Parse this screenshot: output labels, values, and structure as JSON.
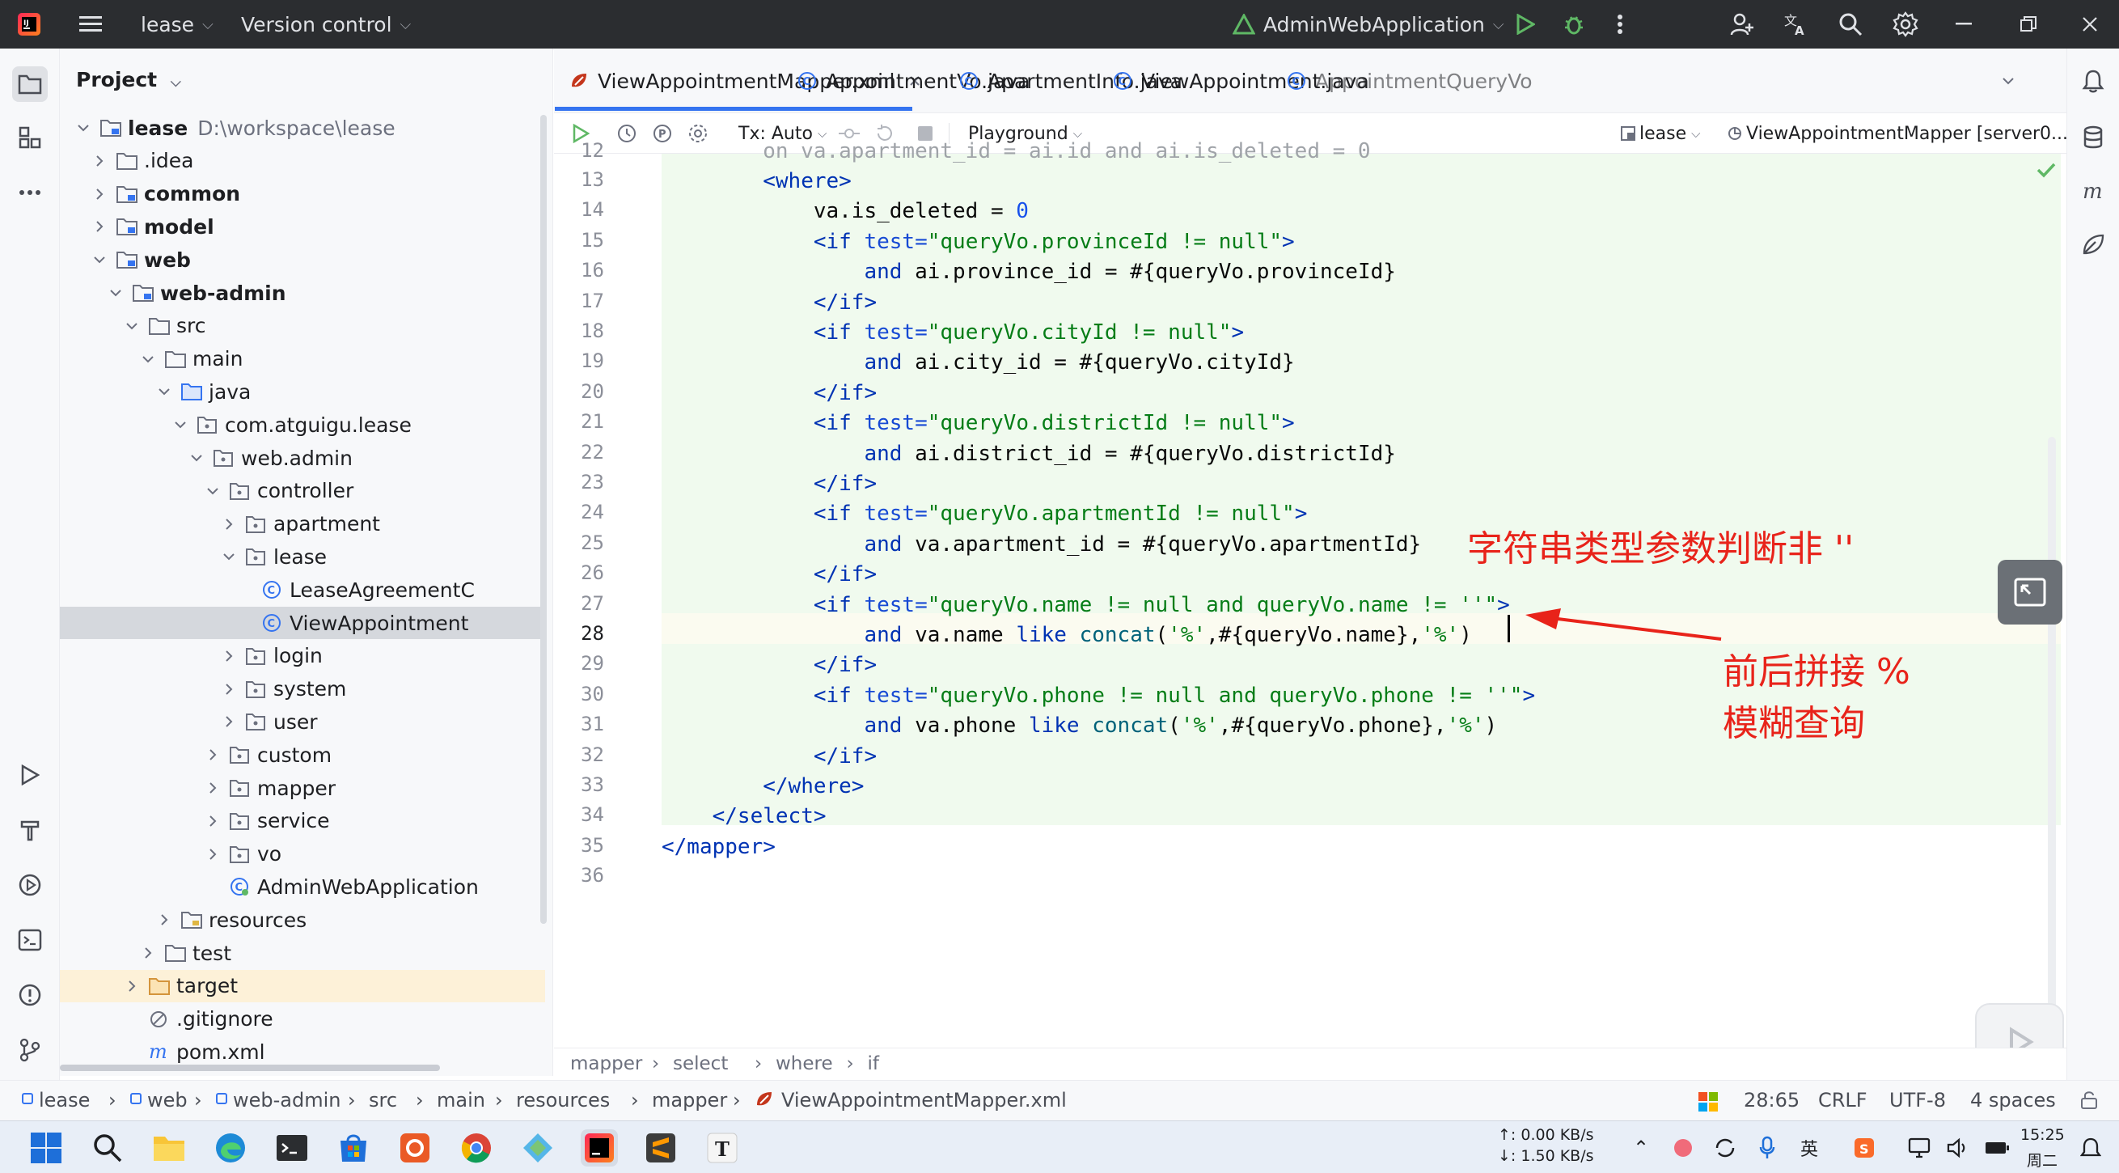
{
  "titlebar": {
    "project": "lease",
    "vcs": "Version control",
    "run_config": "AdminWebApplication"
  },
  "project_panel": {
    "title": "Project",
    "tree": [
      {
        "label": "lease",
        "path": "D:\\workspace\\lease",
        "bold": true,
        "level": 0,
        "open": true,
        "icon": "module"
      },
      {
        "label": ".idea",
        "level": 1,
        "open": false,
        "icon": "folder"
      },
      {
        "label": "common",
        "level": 1,
        "open": false,
        "icon": "module",
        "bold": true
      },
      {
        "label": "model",
        "level": 1,
        "open": false,
        "icon": "module",
        "bold": true
      },
      {
        "label": "web",
        "level": 1,
        "open": true,
        "icon": "module",
        "bold": true
      },
      {
        "label": "web-admin",
        "level": 2,
        "open": true,
        "icon": "module",
        "bold": true
      },
      {
        "label": "src",
        "level": 3,
        "open": true,
        "icon": "folder"
      },
      {
        "label": "main",
        "level": 4,
        "open": true,
        "icon": "folder"
      },
      {
        "label": "java",
        "level": 5,
        "open": true,
        "icon": "src-folder"
      },
      {
        "label": "com.atguigu.lease",
        "level": 6,
        "open": true,
        "icon": "package"
      },
      {
        "label": "web.admin",
        "level": 7,
        "open": true,
        "icon": "package"
      },
      {
        "label": "controller",
        "level": 8,
        "open": true,
        "icon": "package"
      },
      {
        "label": "apartment",
        "level": 9,
        "open": false,
        "icon": "package"
      },
      {
        "label": "lease",
        "level": 9,
        "open": true,
        "icon": "package"
      },
      {
        "label": "LeaseAgreementC",
        "level": 10,
        "icon": "class"
      },
      {
        "label": "ViewAppointment",
        "level": 10,
        "icon": "class",
        "selected": true
      },
      {
        "label": "login",
        "level": 9,
        "open": false,
        "icon": "package"
      },
      {
        "label": "system",
        "level": 9,
        "open": false,
        "icon": "package"
      },
      {
        "label": "user",
        "level": 9,
        "open": false,
        "icon": "package"
      },
      {
        "label": "custom",
        "level": 8,
        "open": false,
        "icon": "package"
      },
      {
        "label": "mapper",
        "level": 8,
        "open": false,
        "icon": "package"
      },
      {
        "label": "service",
        "level": 8,
        "open": false,
        "icon": "package"
      },
      {
        "label": "vo",
        "level": 8,
        "open": false,
        "icon": "package"
      },
      {
        "label": "AdminWebApplication",
        "level": 8,
        "icon": "spring-class"
      },
      {
        "label": "resources",
        "level": 5,
        "open": false,
        "icon": "res-folder"
      },
      {
        "label": "test",
        "level": 4,
        "open": false,
        "icon": "folder"
      },
      {
        "label": "target",
        "level": 3,
        "open": false,
        "icon": "orange-folder",
        "highlight": true
      },
      {
        "label": ".gitignore",
        "level": 3,
        "icon": "ignore"
      },
      {
        "label": "pom.xml",
        "level": 3,
        "icon": "maven"
      }
    ]
  },
  "tabs": [
    {
      "label": "ViewAppointmentMapper.xml",
      "active": true,
      "icon": "xml"
    },
    {
      "label": "AppointmentVo.java",
      "icon": "class"
    },
    {
      "label": "ApartmentInfo.java",
      "icon": "class"
    },
    {
      "label": "ViewAppointment.java",
      "icon": "class"
    },
    {
      "label": "AppointmentQueryVo",
      "icon": "class"
    }
  ],
  "editor_toolbar": {
    "tx": "Tx: Auto",
    "playground": "Playground",
    "datasource": "lease",
    "session": "ViewAppointmentMapper [server0..."
  },
  "code": {
    "lines": [
      {
        "n": "13",
        "html": "        <span class=\"tag\">&lt;where&gt;</span>"
      },
      {
        "n": "14",
        "html": "            va.is_deleted = <span class=\"num\">0</span>"
      },
      {
        "n": "15",
        "html": "            <span class=\"tag\">&lt;if </span><span class=\"attr\">test=</span><span class=\"str\">\"queryVo.provinceId != null\"</span><span class=\"tag\">&gt;</span>"
      },
      {
        "n": "16",
        "html": "                <span class=\"kw\">and</span> ai.province_id = #{queryVo.provinceId}"
      },
      {
        "n": "17",
        "html": "            <span class=\"tag\">&lt;/if&gt;</span>"
      },
      {
        "n": "18",
        "html": "            <span class=\"tag\">&lt;if </span><span class=\"attr\">test=</span><span class=\"str\">\"queryVo.cityId != null\"</span><span class=\"tag\">&gt;</span>"
      },
      {
        "n": "19",
        "html": "                <span class=\"kw\">and</span> ai.city_id = #{queryVo.cityId}"
      },
      {
        "n": "20",
        "html": "            <span class=\"tag\">&lt;/if&gt;</span>"
      },
      {
        "n": "21",
        "html": "            <span class=\"tag\">&lt;if </span><span class=\"attr\">test=</span><span class=\"str\">\"queryVo.districtId != null\"</span><span class=\"tag\">&gt;</span>"
      },
      {
        "n": "22",
        "html": "                <span class=\"kw\">and</span> ai.district_id = #{queryVo.districtId}"
      },
      {
        "n": "23",
        "html": "            <span class=\"tag\">&lt;/if&gt;</span>"
      },
      {
        "n": "24",
        "html": "            <span class=\"tag\">&lt;if </span><span class=\"attr\">test=</span><span class=\"str\">\"queryVo.apartmentId != null\"</span><span class=\"tag\">&gt;</span>"
      },
      {
        "n": "25",
        "html": "                <span class=\"kw\">and</span> va.apartment_id = #{queryVo.apartmentId}"
      },
      {
        "n": "26",
        "html": "            <span class=\"tag\">&lt;/if&gt;</span>"
      },
      {
        "n": "27",
        "html": "            <span class=\"tag\">&lt;if </span><span class=\"attr\">test=</span><span class=\"str\">\"queryVo.name != null and queryVo.name != ''\"</span><span class=\"tag\">&gt;</span>"
      },
      {
        "n": "28",
        "html": "                <span class=\"kw\">and</span> va.name <span class=\"kw\">like</span> <span class=\"fn\">concat</span>(<span class=\"str\">'%'</span>,#{queryVo.name},<span class=\"str\">'%'</span>)"
      },
      {
        "n": "29",
        "html": "            <span class=\"tag\">&lt;/if&gt;</span>"
      },
      {
        "n": "30",
        "html": "            <span class=\"tag\">&lt;if </span><span class=\"attr\">test=</span><span class=\"str\">\"queryVo.phone != null and queryVo.phone != ''\"</span><span class=\"tag\">&gt;</span>"
      },
      {
        "n": "31",
        "html": "                <span class=\"kw\">and</span> va.phone <span class=\"kw\">like</span> <span class=\"fn\">concat</span>(<span class=\"str\">'%'</span>,#{queryVo.phone},<span class=\"str\">'%'</span>)"
      },
      {
        "n": "32",
        "html": "            <span class=\"tag\">&lt;/if&gt;</span>"
      },
      {
        "n": "33",
        "html": "        <span class=\"tag\">&lt;/where&gt;</span>"
      },
      {
        "n": "34",
        "html": "    <span class=\"tag\">&lt;/select&gt;</span>"
      },
      {
        "n": "35",
        "html": "<span class=\"tag\">&lt;/mapper&gt;</span>"
      },
      {
        "n": "36",
        "html": ""
      }
    ],
    "current_line": "28"
  },
  "annotations": {
    "string_note": "字符串类型参数判断非 ''",
    "concat_note_1": "前后拼接 %",
    "concat_note_2": "模糊查询"
  },
  "breadcrumb": [
    "mapper",
    "select",
    "where",
    "if"
  ],
  "status": {
    "path": [
      "lease",
      "web",
      "web-admin",
      "src",
      "main",
      "resources",
      "mapper",
      "ViewAppointmentMapper.xml"
    ],
    "position": "28:65",
    "line_sep": "CRLF",
    "encoding": "UTF-8",
    "indent": "4 spaces"
  },
  "tray": {
    "up": "↑: 0.00 KB/s",
    "down": "↓: 1.50 KB/s",
    "time": "15:25",
    "day": "周二"
  },
  "colors": {
    "accent": "#3574f0",
    "annotation": "#e8231a"
  }
}
